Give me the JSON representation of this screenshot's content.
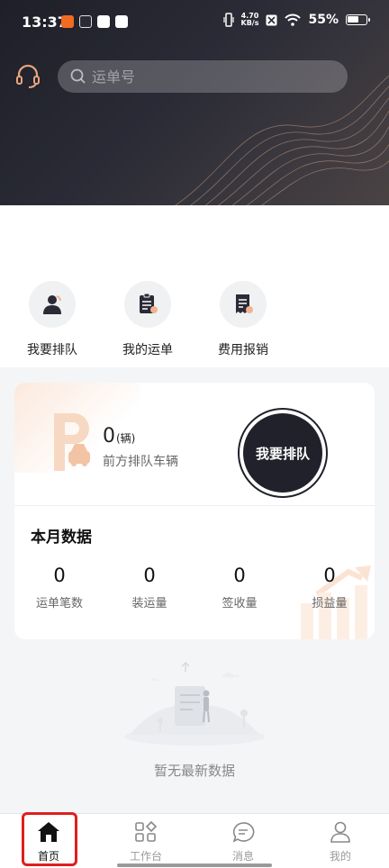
{
  "status_bar": {
    "time": "13:37",
    "net_speed_top": "4.70",
    "net_speed_bottom": "KB/s",
    "battery": "55%"
  },
  "search": {
    "placeholder": "运单号"
  },
  "quick_actions": [
    {
      "label": "我要排队",
      "icon": "driver-icon"
    },
    {
      "label": "我的运单",
      "icon": "waybill-icon"
    },
    {
      "label": "费用报销",
      "icon": "receipt-icon"
    }
  ],
  "queue": {
    "count": "0",
    "unit": "(辆)",
    "label": "前方排队车辆",
    "button_label": "我要排队"
  },
  "monthly": {
    "title": "本月数据",
    "stats": [
      {
        "value": "0",
        "label": "运单笔数"
      },
      {
        "value": "0",
        "label": "装运量"
      },
      {
        "value": "0",
        "label": "签收量"
      },
      {
        "value": "0",
        "label": "损益量"
      }
    ]
  },
  "empty": {
    "text": "暂无最新数据"
  },
  "tabbar": [
    {
      "label": "首页",
      "icon": "home-icon",
      "active": true
    },
    {
      "label": "工作台",
      "icon": "grid-icon",
      "active": false
    },
    {
      "label": "消息",
      "icon": "chat-icon",
      "active": false
    },
    {
      "label": "我的",
      "icon": "user-icon",
      "active": false
    }
  ],
  "colors": {
    "accent_dark": "#20212b",
    "highlight_red": "#e01e1e",
    "soft_orange": "#f7d8c2"
  }
}
